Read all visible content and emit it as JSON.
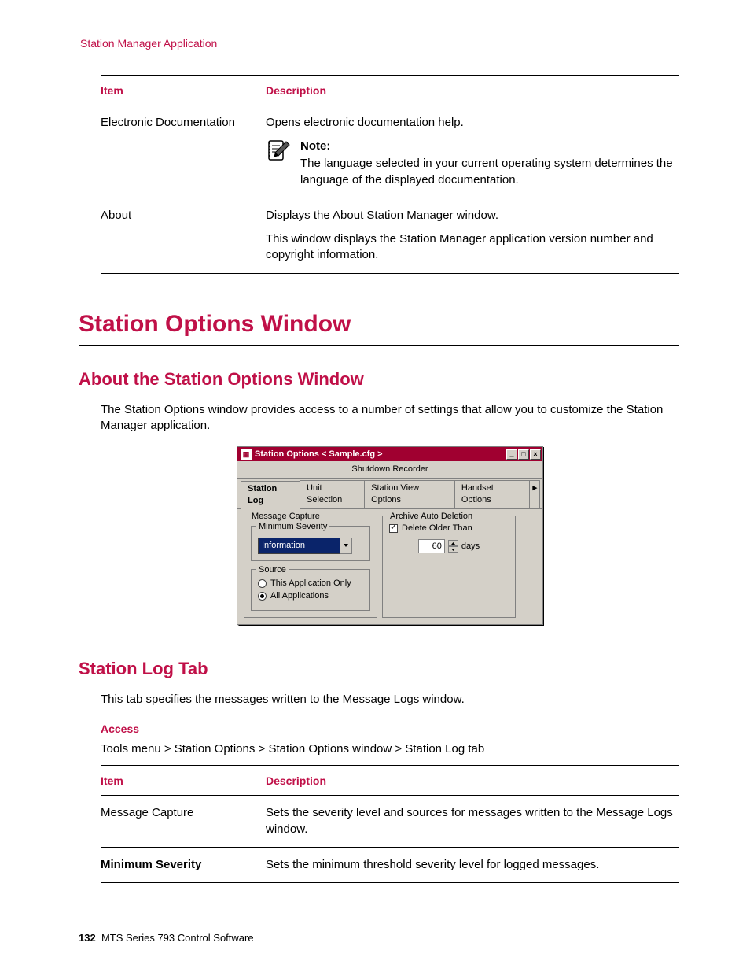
{
  "running_header": "Station Manager Application",
  "table1": {
    "head_item": "Item",
    "head_desc": "Description",
    "rows": [
      {
        "item": "Electronic Documentation",
        "desc1": "Opens electronic documentation help.",
        "note_label": "Note:",
        "note_text": "The language selected in your current operating system determines the language of the displayed documentation."
      },
      {
        "item": "About",
        "desc1": "Displays the About Station Manager window.",
        "desc2": "This window displays the Station Manager application version number and copyright information."
      }
    ]
  },
  "h1": "Station Options Window",
  "h2a": "About the Station Options Window",
  "para1": "The Station Options window provides access to a number of settings that allow you to customize the Station Manager application.",
  "win": {
    "title": "Station Options < Sample.cfg >",
    "menu": "Shutdown Recorder",
    "tabs": [
      "Station Log",
      "Unit Selection",
      "Station View Options",
      "Handset Options"
    ],
    "msg_capture": "Message Capture",
    "min_sev": "Minimum Severity",
    "combo_val": "Information",
    "source": "Source",
    "radio1": "This Application Only",
    "radio2": "All Applications",
    "archive": "Archive Auto Deletion",
    "delete_older": "Delete Older Than",
    "days_val": "60",
    "days_label": "days"
  },
  "h2b": "Station Log Tab",
  "para2": "This tab specifies the messages written to the Message Logs window.",
  "access_label": "Access",
  "access_path": "Tools menu > Station Options > Station Options window > Station Log tab",
  "table2": {
    "head_item": "Item",
    "head_desc": "Description",
    "rows": [
      {
        "item": "Message Capture",
        "desc": "Sets the severity level and sources for messages written to the Message Logs window."
      },
      {
        "item": "Minimum Severity",
        "bold": true,
        "desc": "Sets the minimum threshold severity level for logged messages."
      }
    ]
  },
  "footer": {
    "page": "132",
    "text": "MTS Series 793 Control Software"
  }
}
